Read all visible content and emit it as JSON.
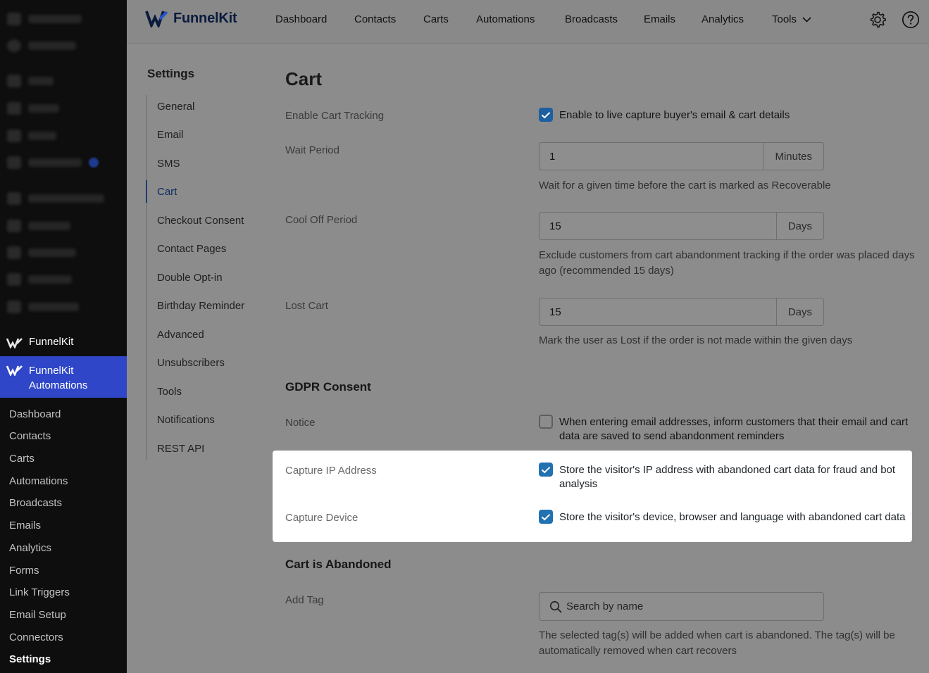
{
  "wp_sidebar": {
    "funnelkit_label": "FunnelKit",
    "automations_label_line1": "FunnelKit",
    "automations_label_line2": "Automations",
    "submenu": [
      {
        "label": "Dashboard"
      },
      {
        "label": "Contacts"
      },
      {
        "label": "Carts"
      },
      {
        "label": "Automations"
      },
      {
        "label": "Broadcasts"
      },
      {
        "label": "Emails"
      },
      {
        "label": "Analytics"
      },
      {
        "label": "Forms"
      },
      {
        "label": "Link Triggers"
      },
      {
        "label": "Email Setup"
      },
      {
        "label": "Connectors"
      },
      {
        "label": "Settings"
      }
    ]
  },
  "header": {
    "logo_funnel": "Funnel",
    "logo_kit": "Kit",
    "nav": [
      {
        "label": "Dashboard"
      },
      {
        "label": "Contacts"
      },
      {
        "label": "Carts"
      },
      {
        "label": "Automations"
      },
      {
        "label": "Broadcasts"
      },
      {
        "label": "Emails"
      },
      {
        "label": "Analytics"
      },
      {
        "label": "Tools"
      }
    ]
  },
  "settings_nav": {
    "title": "Settings",
    "items": [
      {
        "label": "General"
      },
      {
        "label": "Email"
      },
      {
        "label": "SMS"
      },
      {
        "label": "Cart"
      },
      {
        "label": "Checkout Consent"
      },
      {
        "label": "Contact Pages"
      },
      {
        "label": "Double Opt-in"
      },
      {
        "label": "Birthday Reminder"
      },
      {
        "label": "Advanced"
      },
      {
        "label": "Unsubscribers"
      },
      {
        "label": "Tools"
      },
      {
        "label": "Notifications"
      },
      {
        "label": "REST API"
      }
    ]
  },
  "content": {
    "page_title": "Cart",
    "enable_tracking": {
      "label": "Enable Cart Tracking",
      "option": "Enable to live capture buyer's email & cart details",
      "checked": true
    },
    "wait_period": {
      "label": "Wait Period",
      "value": "1",
      "unit": "Minutes",
      "help": "Wait for a given time before the cart is marked as Recoverable"
    },
    "cool_off": {
      "label": "Cool Off Period",
      "value": "15",
      "unit": "Days",
      "help_line1": "Exclude customers from cart abandonment tracking if the order was placed days",
      "help_line2": "ago (recommended 15 days)"
    },
    "lost_cart": {
      "label": "Lost Cart",
      "value": "15",
      "unit": "Days",
      "help": "Mark the user as Lost if the order is not made within the given days"
    },
    "gdpr": {
      "heading": "GDPR Consent",
      "notice_label": "Notice",
      "notice_line1": "When entering email addresses, inform customers that their email and cart",
      "notice_line2": "data are saved to send abandonment reminders",
      "notice_checked": false
    },
    "capture_ip": {
      "label": "Capture IP Address",
      "line1": "Store the visitor's IP address with abandoned cart data for fraud and bot",
      "line2": "analysis",
      "checked": true
    },
    "capture_device": {
      "label": "Capture Device",
      "option": "Store the visitor's device, browser and language with abandoned cart data",
      "checked": true
    },
    "abandoned": {
      "heading": "Cart is Abandoned",
      "add_tag_label": "Add Tag",
      "search_placeholder": "Search by name",
      "help_line1": "The selected tag(s) will be added when cart is abandoned. The tag(s) will be",
      "help_line2": "automatically removed when cart recovers"
    }
  },
  "colors": {
    "accent": "#2271b1",
    "sidebar_active": "#2e46c7",
    "overlay": "#8c8c8c"
  }
}
